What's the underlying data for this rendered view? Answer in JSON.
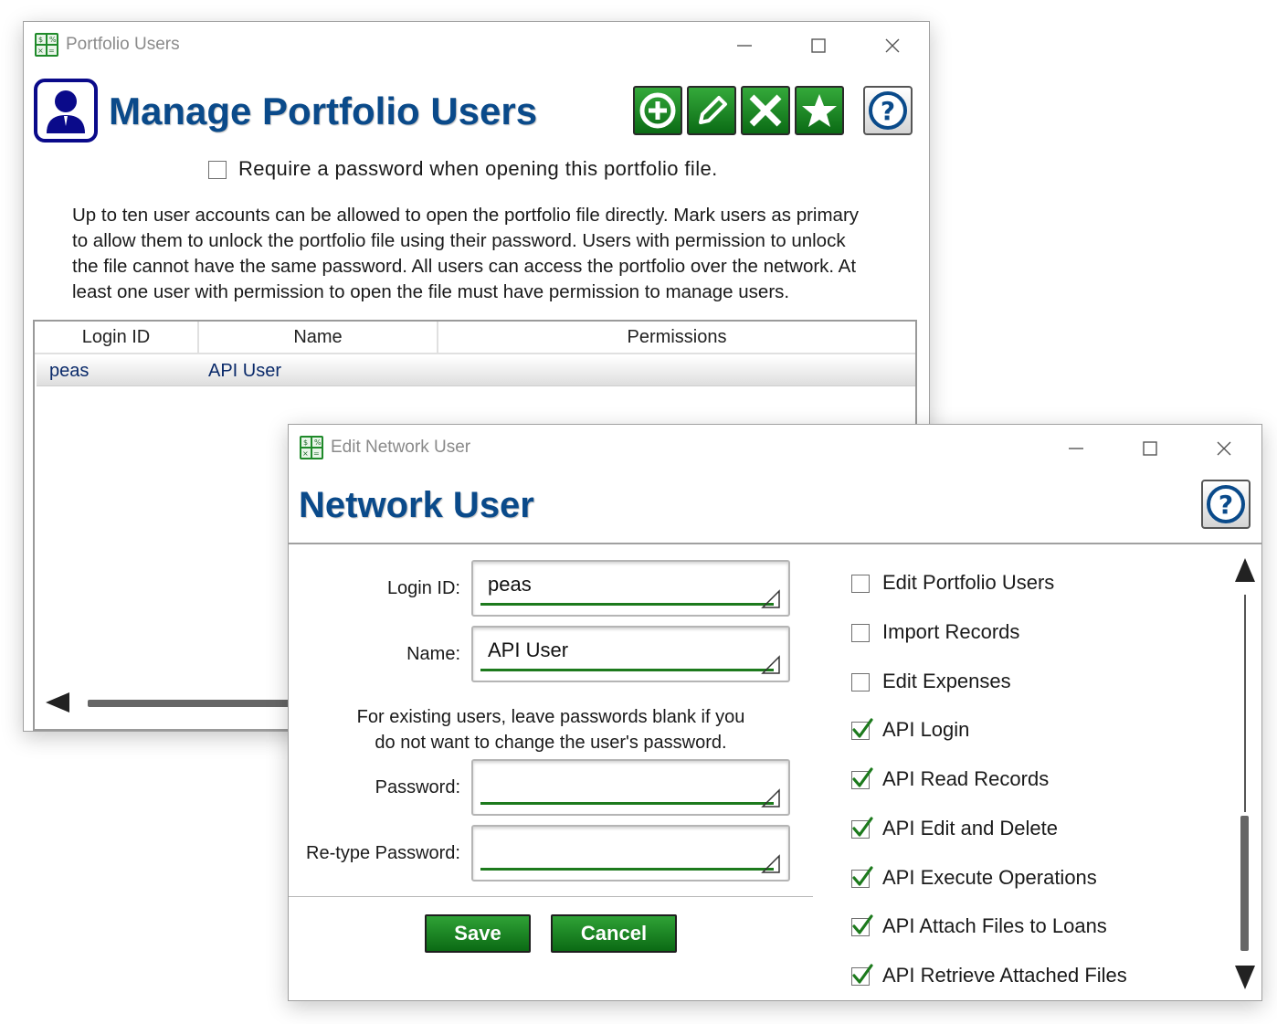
{
  "main_window": {
    "title": "Portfolio Users",
    "heading": "Manage Portfolio Users",
    "require_password_label": "Require a password when opening this portfolio file.",
    "require_password_checked": false,
    "description": [
      "Up to ten user accounts can be allowed to open the portfolio file directly. Mark users as primary",
      "to allow them to unlock the portfolio file using their password. Users with permission to unlock",
      "the file cannot have the same password. All users can access the portfolio over the network. At",
      "least one user with permission to open the file must have permission to manage users."
    ],
    "toolbar": [
      "add-icon",
      "edit-icon",
      "delete-icon",
      "star-icon",
      "help-icon"
    ],
    "table": {
      "columns": [
        "Login ID",
        "Name",
        "Permissions"
      ],
      "rows": [
        {
          "login_id": "peas",
          "name": "API User",
          "permissions": ""
        }
      ]
    }
  },
  "edit_dialog": {
    "title": "Edit Network User",
    "heading": "Network User",
    "fields": {
      "login_id": {
        "label": "Login ID:",
        "value": "peas"
      },
      "name": {
        "label": "Name:",
        "value": "API User"
      },
      "password": {
        "label": "Password:",
        "value": ""
      },
      "retype_password": {
        "label": "Re-type Password:",
        "value": ""
      }
    },
    "password_hint": [
      "For existing users, leave passwords blank if you",
      "do not want to change the user's password."
    ],
    "buttons": {
      "save": "Save",
      "cancel": "Cancel"
    },
    "permissions": [
      {
        "label": "Edit Portfolio Users",
        "checked": false
      },
      {
        "label": "Import Records",
        "checked": false
      },
      {
        "label": "Edit Expenses",
        "checked": false
      },
      {
        "label": "API Login",
        "checked": true
      },
      {
        "label": "API Read Records",
        "checked": true
      },
      {
        "label": "API Edit and Delete",
        "checked": true
      },
      {
        "label": "API Execute Operations",
        "checked": true
      },
      {
        "label": "API Attach Files to Loans",
        "checked": true
      },
      {
        "label": "API Retrieve Attached Files",
        "checked": true
      }
    ]
  },
  "colors": {
    "accent": "#0a4a8a",
    "button_green": "#0b7a18",
    "underline_green": "#1d7a1d"
  }
}
